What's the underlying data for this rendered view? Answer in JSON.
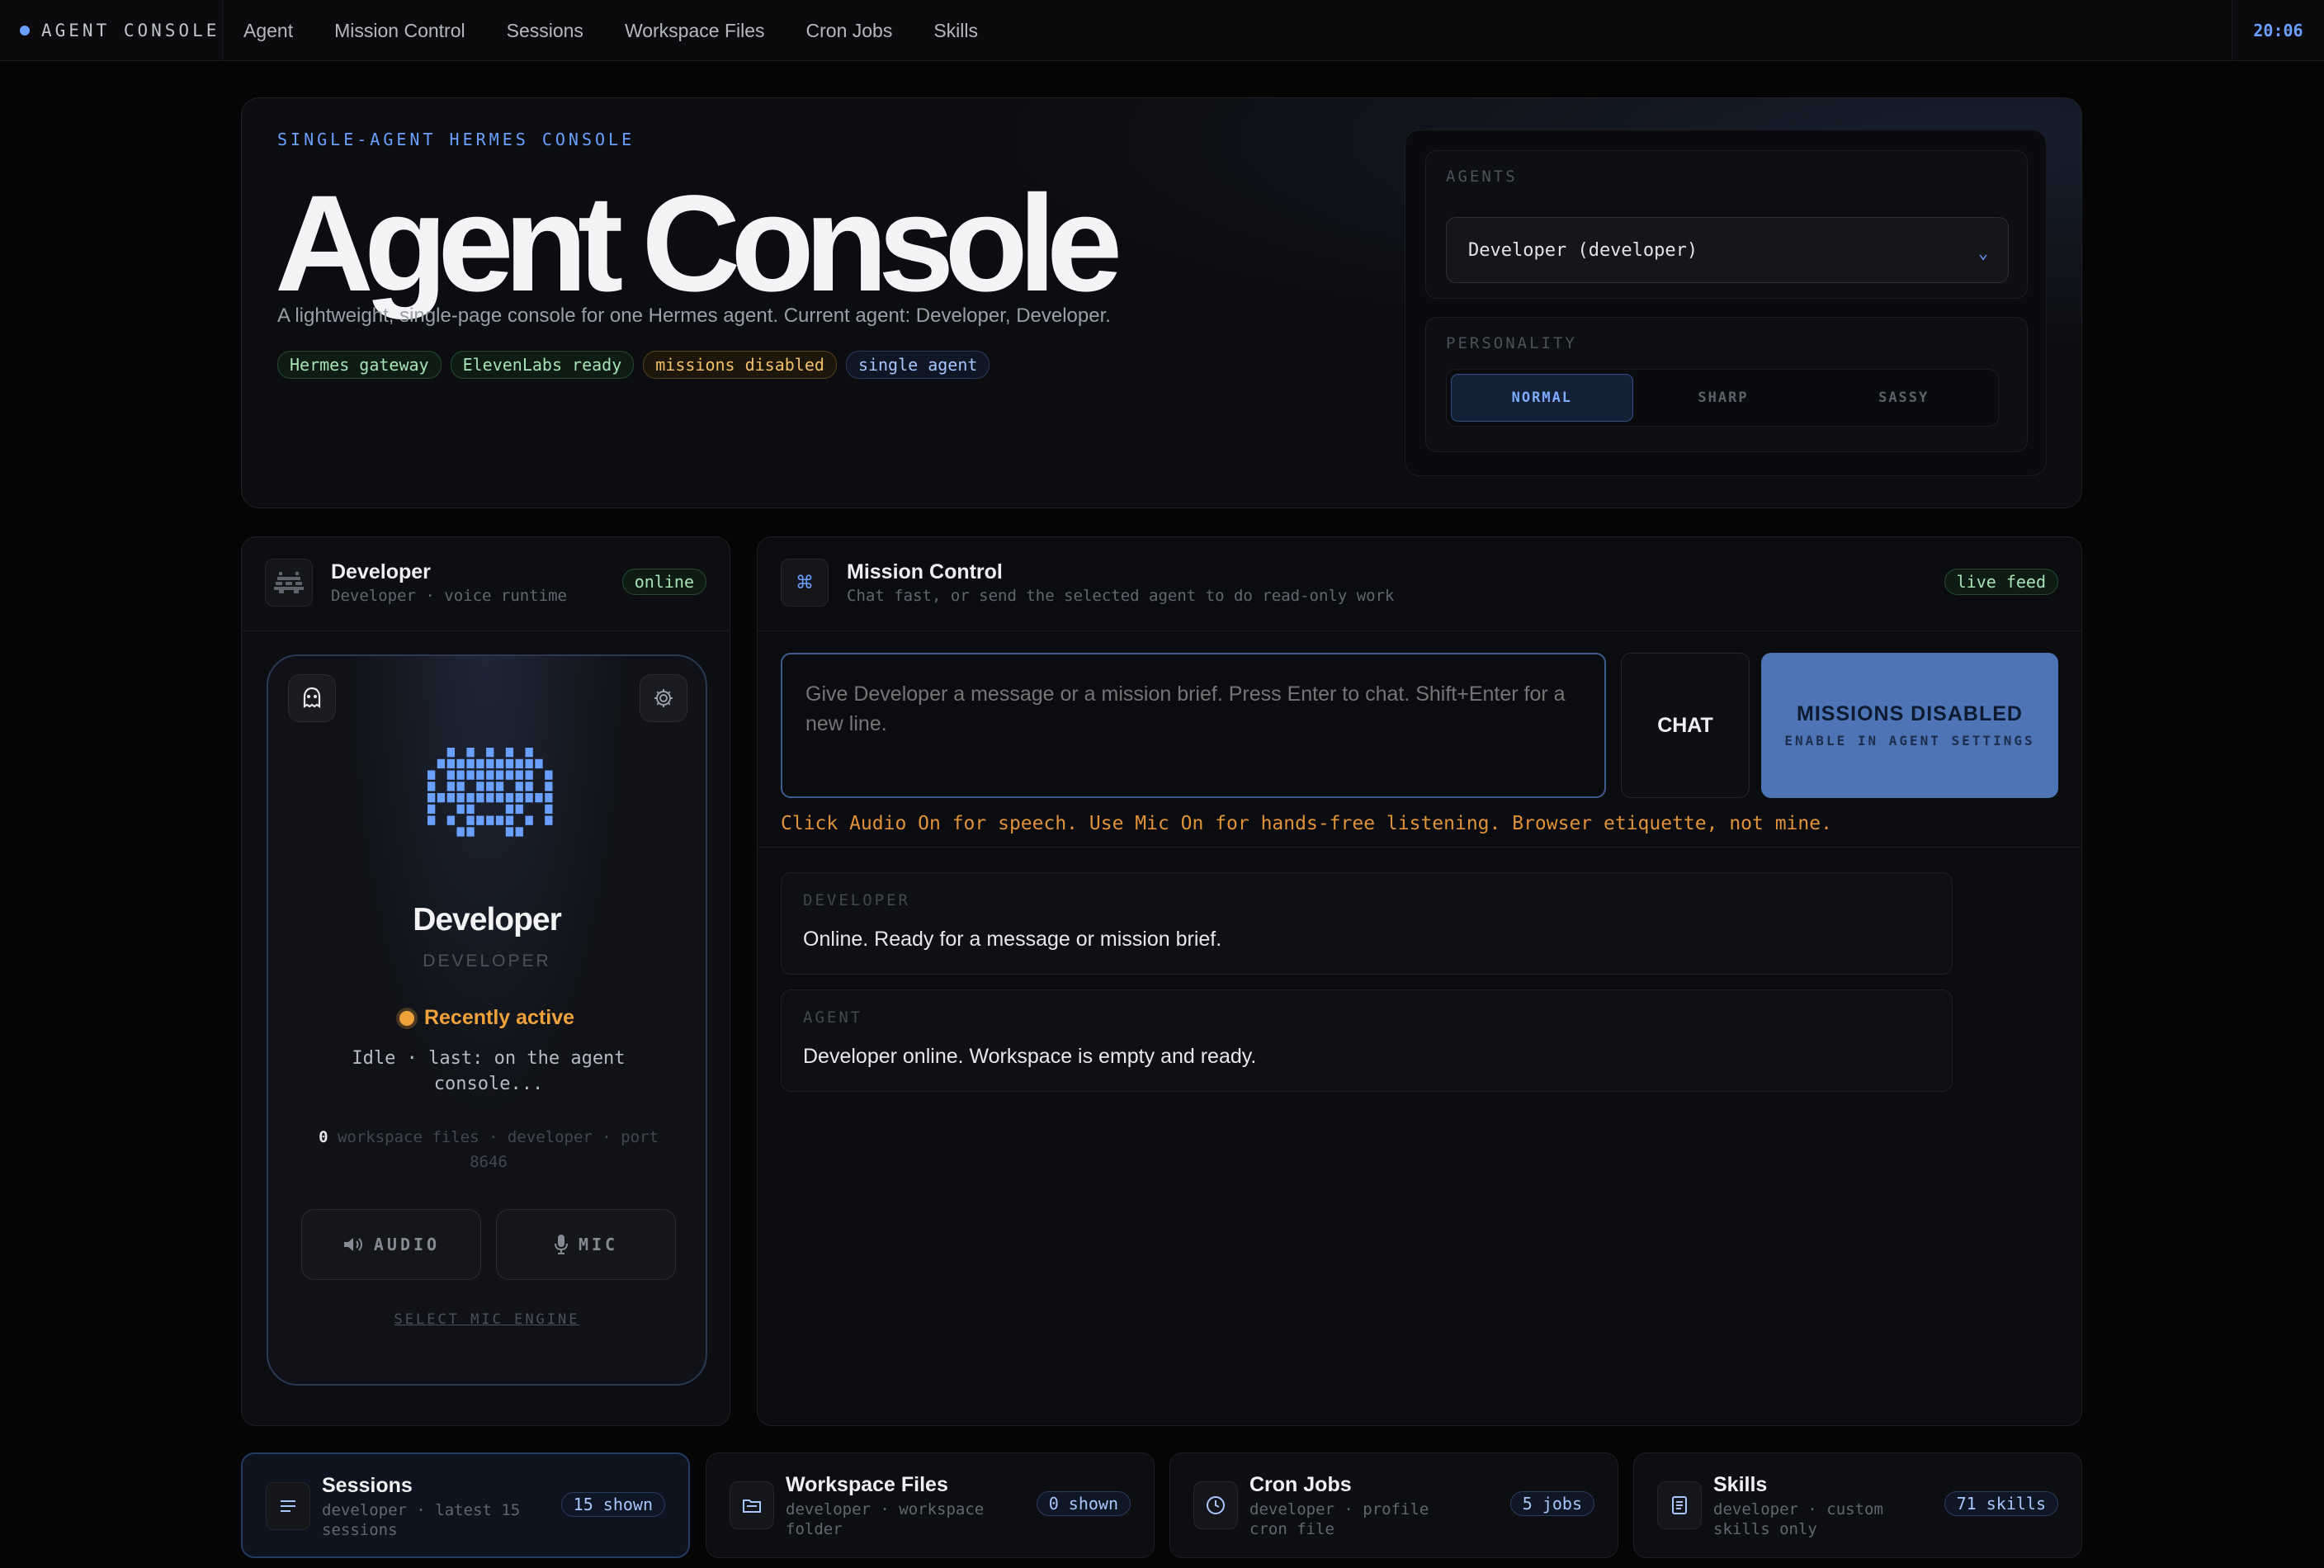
{
  "nav": {
    "brand": "AGENT CONSOLE",
    "items": [
      "Agent",
      "Mission Control",
      "Sessions",
      "Workspace Files",
      "Cron Jobs",
      "Skills"
    ],
    "clock": "20:06"
  },
  "hero": {
    "eyebrow": "SINGLE-AGENT HERMES CONSOLE",
    "title": "Agent Console",
    "subtitle": "A lightweight, single-page console for one Hermes agent. Current agent: Developer, Developer.",
    "tags": [
      {
        "label": "Hermes gateway",
        "color": "green"
      },
      {
        "label": "ElevenLabs ready",
        "color": "green"
      },
      {
        "label": "missions disabled",
        "color": "amber"
      },
      {
        "label": "single agent",
        "color": "blue"
      }
    ],
    "agents_label": "AGENTS",
    "agent_selected": "Developer (developer)",
    "personality_label": "PERSONALITY",
    "personalities": [
      "NORMAL",
      "SHARP",
      "SASSY"
    ],
    "personality_active": "NORMAL"
  },
  "agent_panel": {
    "title": "Developer",
    "subtitle": "Developer · voice runtime",
    "status": "online",
    "card": {
      "name": "Developer",
      "role": "DEVELOPER",
      "activity": "Recently active",
      "idle": "Idle · last: on the agent console...",
      "files_count": "0",
      "stats": " workspace files · developer · port 8646",
      "audio_label": "AUDIO",
      "mic_label": "MIC",
      "mic_engine": "SELECT MIC ENGINE"
    }
  },
  "mission": {
    "title": "Mission Control",
    "subtitle": "Chat fast, or send the selected agent to do read-only work",
    "status": "live feed",
    "input_placeholder": "Give Developer a message or a mission brief. Press Enter to chat. Shift+Enter for a new line.",
    "chat_button": "CHAT",
    "missions_button": "MISSIONS DISABLED",
    "missions_button_sub": "ENABLE IN AGENT SETTINGS",
    "hint": "Click Audio On for speech. Use Mic On for hands-free listening. Browser etiquette, not mine.",
    "messages": [
      {
        "who": "DEVELOPER",
        "text": "Online. Ready for a message or mission brief."
      },
      {
        "who": "AGENT",
        "text": "Developer online. Workspace is empty and ready."
      }
    ]
  },
  "bottom_cards": [
    {
      "title": "Sessions",
      "subtitle": "developer · latest 15 sessions",
      "badge": "15 shown",
      "icon": "list-icon"
    },
    {
      "title": "Workspace Files",
      "subtitle": "developer · workspace folder",
      "badge": "0 shown",
      "icon": "folder-icon"
    },
    {
      "title": "Cron Jobs",
      "subtitle": "developer · profile cron file",
      "badge": "5 jobs",
      "icon": "clock-icon"
    },
    {
      "title": "Skills",
      "subtitle": "developer · custom skills only",
      "badge": "71 skills",
      "icon": "document-icon"
    }
  ],
  "colors": {
    "accent": "#6aa0ff",
    "warning": "#f0a23a",
    "success": "#a6e3b6",
    "mission_button": "#4d74b5"
  }
}
